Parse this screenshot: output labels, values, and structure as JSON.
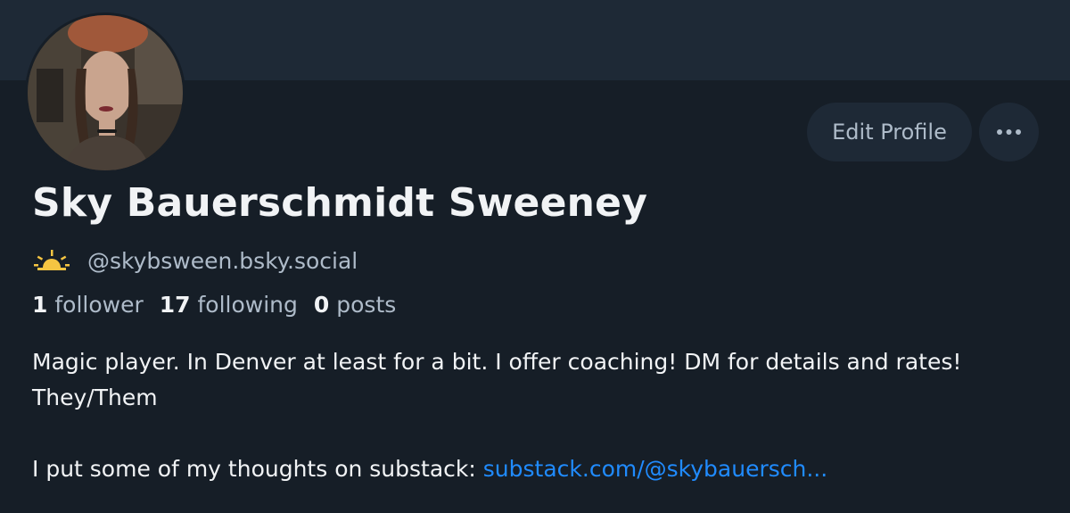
{
  "profile": {
    "display_name": "Sky Bauerschmidt Sweeney",
    "handle": "@skybsween.bsky.social",
    "badge_icon": "sunrise-icon",
    "stats": {
      "followers_count": "1",
      "followers_label": "follower",
      "following_count": "17",
      "following_label": "following",
      "posts_count": "0",
      "posts_label": "posts"
    },
    "bio": {
      "line1": "Magic player. In Denver at least for a bit. I offer coaching! DM for details and rates! They/Them",
      "line2_prefix": "I put some of my thoughts on substack: ",
      "line2_link": "substack.com/@skybauersch..."
    }
  },
  "actions": {
    "edit_profile_label": "Edit Profile",
    "more_icon": "ellipsis-icon"
  },
  "colors": {
    "background": "#161e27",
    "banner": "#1e2936",
    "button_bg": "#1e2936",
    "text_primary": "#f1f3f5",
    "text_secondary": "#aebbc9",
    "link": "#208bfe",
    "badge": "#f5c542"
  }
}
